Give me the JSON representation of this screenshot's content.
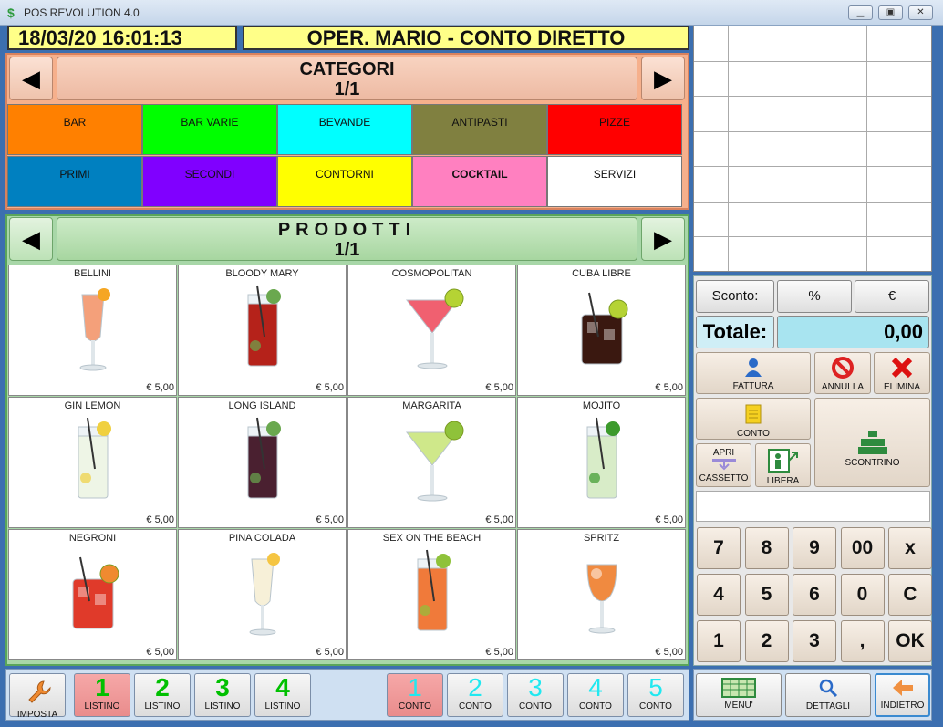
{
  "window": {
    "title": "POS REVOLUTION 4.0",
    "icon": "dollar-icon"
  },
  "header": {
    "datetime": "18/03/20 16:01:13",
    "operator": "OPER. MARIO - CONTO DIRETTO"
  },
  "categories": {
    "title": "CATEGORI",
    "page": "1/1",
    "items": [
      {
        "label": "BAR",
        "color": "#ff8000",
        "bold": false
      },
      {
        "label": "BAR VARIE",
        "color": "#00ff00",
        "bold": false
      },
      {
        "label": "BEVANDE",
        "color": "#00ffff",
        "bold": false
      },
      {
        "label": "ANTIPASTI",
        "color": "#808040",
        "bold": false
      },
      {
        "label": "PIZZE",
        "color": "#ff0000",
        "bold": false
      },
      {
        "label": "PRIMI",
        "color": "#0080c0",
        "bold": false
      },
      {
        "label": "SECONDI",
        "color": "#8000ff",
        "bold": false
      },
      {
        "label": "CONTORNI",
        "color": "#ffff00",
        "bold": false
      },
      {
        "label": "COCKTAIL",
        "color": "#ff80c0",
        "bold": true
      },
      {
        "label": "SERVIZI",
        "color": "#ffffff",
        "bold": false
      }
    ]
  },
  "products": {
    "title": "PRODOTTI",
    "page": "1/1",
    "items": [
      {
        "name": "BELLINI",
        "price": "€ 5,00",
        "glass": "flute",
        "drink": "#f4a07a",
        "garnish": "#f5a623"
      },
      {
        "name": "BLOODY MARY",
        "price": "€ 5,00",
        "glass": "highball",
        "drink": "#b5221a",
        "garnish": "#6aa84f"
      },
      {
        "name": "COSMOPOLITAN",
        "price": "€ 5,00",
        "glass": "martini",
        "drink": "#f06070",
        "garnish": "#b5d334"
      },
      {
        "name": "CUBA LIBRE",
        "price": "€ 5,00",
        "glass": "rocks",
        "drink": "#3a1810",
        "garnish": "#b5d334"
      },
      {
        "name": "GIN LEMON",
        "price": "€ 5,00",
        "glass": "highball",
        "drink": "#eef5e6",
        "garnish": "#f0d040"
      },
      {
        "name": "LONG ISLAND",
        "price": "€ 5,00",
        "glass": "highball",
        "drink": "#4a2030",
        "garnish": "#6aa84f"
      },
      {
        "name": "MARGARITA",
        "price": "€ 5,00",
        "glass": "martini",
        "drink": "#cfe88a",
        "garnish": "#8fc23a"
      },
      {
        "name": "MOJITO",
        "price": "€ 5,00",
        "glass": "highball",
        "drink": "#d8ecc8",
        "garnish": "#3c9a2c"
      },
      {
        "name": "NEGRONI",
        "price": "€ 5,00",
        "glass": "rocks",
        "drink": "#e03a2a",
        "garnish": "#f08a30"
      },
      {
        "name": "PINA COLADA",
        "price": "€ 5,00",
        "glass": "flute",
        "drink": "#f7f0d8",
        "garnish": "#f5c542"
      },
      {
        "name": "SEX ON THE BEACH",
        "price": "€ 5,00",
        "glass": "highball",
        "drink": "#f07a3a",
        "garnish": "#8fc23a"
      },
      {
        "name": "SPRITZ",
        "price": "€ 5,00",
        "glass": "wine",
        "drink": "#f08a40",
        "garnish": "#f08a40"
      }
    ]
  },
  "listini": [
    {
      "num": "1",
      "label": "LISTINO",
      "active": true
    },
    {
      "num": "2",
      "label": "LISTINO",
      "active": false
    },
    {
      "num": "3",
      "label": "LISTINO",
      "active": false
    },
    {
      "num": "4",
      "label": "LISTINO",
      "active": false
    }
  ],
  "imposta": {
    "label": "IMPOSTA",
    "icon": "wrench-icon"
  },
  "conti": [
    {
      "num": "1",
      "label": "CONTO",
      "active": true
    },
    {
      "num": "2",
      "label": "CONTO",
      "active": false
    },
    {
      "num": "3",
      "label": "CONTO",
      "active": false
    },
    {
      "num": "4",
      "label": "CONTO",
      "active": false
    },
    {
      "num": "5",
      "label": "CONTO",
      "active": false
    }
  ],
  "discount": {
    "label": "Sconto:",
    "percent": "%",
    "euro": "€"
  },
  "total": {
    "label": "Totale:",
    "value": "0,00"
  },
  "actions": {
    "fattura": "FATTURA",
    "annulla": "ANNULLA",
    "elimina": "ELIMINA",
    "conto": "CONTO",
    "scontrino": "SCONTRINO",
    "apri": "APRI",
    "cassetto": "CASSETTO",
    "libera": "LIBERA"
  },
  "keypad": [
    "7",
    "8",
    "9",
    "00",
    "x",
    "4",
    "5",
    "6",
    "0",
    "C",
    "1",
    "2",
    "3",
    ",",
    "OK"
  ],
  "footer": {
    "menu": "MENU'",
    "dettagli": "DETTAGLI",
    "indietro": "INDIETRO"
  }
}
